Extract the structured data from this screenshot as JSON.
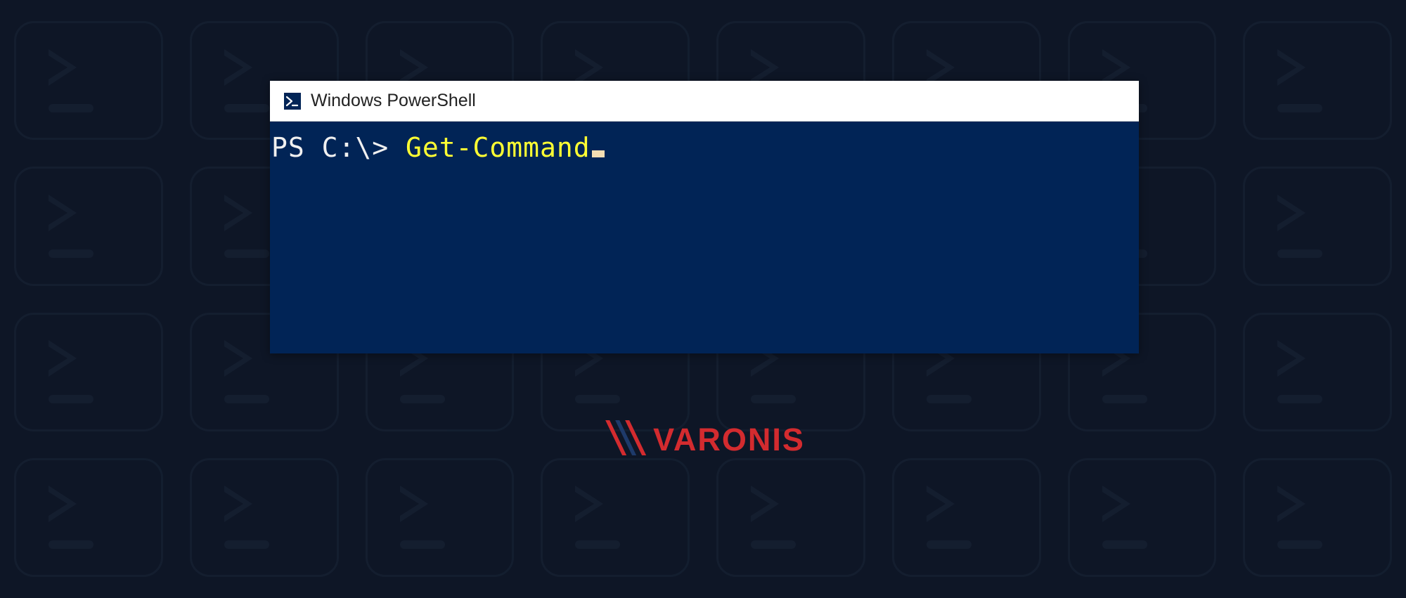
{
  "window": {
    "title": "Windows PowerShell",
    "prompt_prefix": "PS C:\\> ",
    "command": "Get-Command"
  },
  "brand": {
    "name": "VARONIS"
  }
}
